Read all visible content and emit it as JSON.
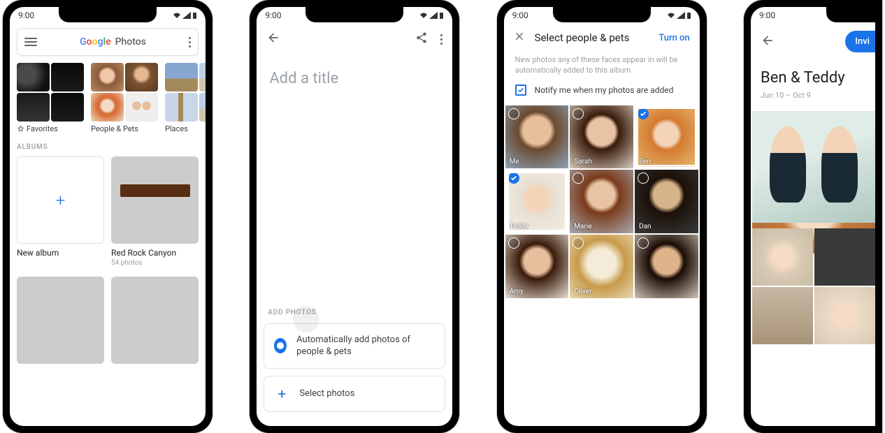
{
  "status": {
    "time": "9:00"
  },
  "screen1": {
    "brand_photos": "Photos",
    "categories": {
      "favorites": "Favorites",
      "people_pets": "People & Pets",
      "places": "Places"
    },
    "section_albums": "ALBUMS",
    "album_new": "New album",
    "album_red_rock": {
      "title": "Red Rock Canyon",
      "subtitle": "54 photos"
    }
  },
  "screen2": {
    "title_placeholder": "Add a title",
    "section_add_photos": "ADD PHOTOS",
    "option_auto": "Automatically add photos of people & pets",
    "option_select": "Select photos"
  },
  "screen3": {
    "title": "Select people & pets",
    "action": "Turn on",
    "help": "New photos any of these faces appear in will be automatically added to this album",
    "notify": "Notify me when my photos are added",
    "faces": {
      "me": "Me",
      "sarah": "Sarah",
      "ben": "Ben",
      "teddy": "Teddy",
      "marie": "Marie",
      "dan": "Dan",
      "amy": "Amy",
      "oliver": "Oliver"
    }
  },
  "screen4": {
    "invite": "Invi",
    "title": "Ben & Teddy",
    "dates": "Jun 10 – Oct 9"
  }
}
